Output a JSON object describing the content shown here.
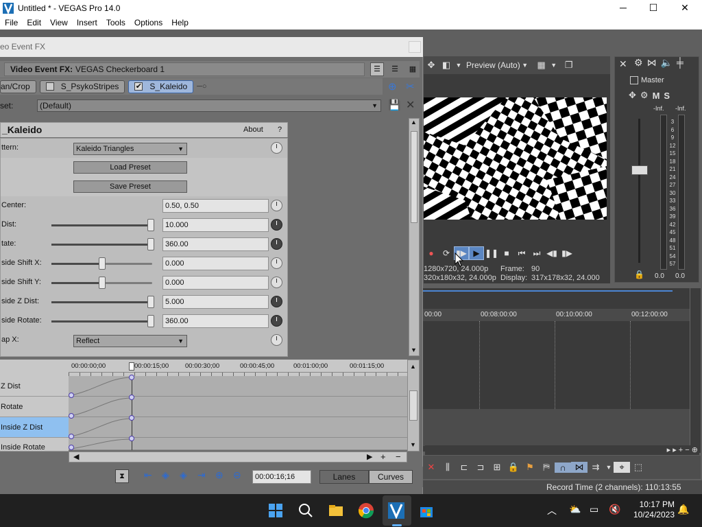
{
  "window": {
    "title": "Untitled * - VEGAS Pro 14.0",
    "controls": {
      "minimize": "─",
      "maximize": "☐",
      "close": "✕"
    }
  },
  "menu": [
    "File",
    "Edit",
    "View",
    "Insert",
    "Tools",
    "Options",
    "Help"
  ],
  "fx_window": {
    "title": "eo Event FX",
    "header_label": "Video Event FX:",
    "header_value": "VEGAS Checkerboard 1",
    "chain": [
      "an/Crop",
      "S_PsykoStripes",
      "S_Kaleido"
    ],
    "preset_label": "set:",
    "preset_value": "(Default)",
    "plugin_name": "_Kaleido",
    "about": "About",
    "help": "?",
    "params": [
      {
        "label": "ttern:",
        "type": "dropdown",
        "value": "Kaleido Triangles"
      },
      {
        "label": "",
        "type": "button",
        "value": "Load Preset"
      },
      {
        "label": "",
        "type": "button",
        "value": "Save Preset"
      },
      {
        "label": "  Center:",
        "type": "text",
        "value": "0.50, 0.50"
      },
      {
        "label": "Dist:",
        "type": "slider",
        "value": "10.000",
        "level": 1.0
      },
      {
        "label": "tate:",
        "type": "slider",
        "value": "360.00",
        "level": 1.0
      },
      {
        "label": "side Shift X:",
        "type": "slider",
        "value": "0.000",
        "level": 0.5
      },
      {
        "label": "side Shift Y:",
        "type": "slider",
        "value": "0.000",
        "level": 0.5
      },
      {
        "label": "side Z Dist:",
        "type": "slider",
        "value": "5.000",
        "level": 1.0
      },
      {
        "label": "side Rotate:",
        "type": "slider",
        "value": "360.00",
        "level": 1.0
      },
      {
        "label": "ap X:",
        "type": "dropdown",
        "value": "Reflect"
      }
    ],
    "kf_ruler": [
      "00:00:00;00",
      "00:00:15;00",
      "00:00:30;00",
      "00:00:45;00",
      "00:01:00;00",
      "00:01:15;00"
    ],
    "kf_tracks": [
      "Z Dist",
      "Rotate",
      "Inside Z Dist",
      "Inside Rotate"
    ],
    "time": "00:00:16;16",
    "lanes": "Lanes",
    "curves": "Curves"
  },
  "preview": {
    "mode": "Preview (Auto)",
    "info": {
      "project": "1280x720, 24.000p",
      "frame_label": "Frame:",
      "frame": "90",
      "preview_res": "320x180x32, 24.000p",
      "display_label": "Display:",
      "display": "317x178x32, 24.000"
    }
  },
  "master": {
    "label": "Master",
    "m": "M",
    "s": "S",
    "peak_left": "-Inf.",
    "peak_right": "-Inf.",
    "scale": [
      "3",
      "6",
      "9",
      "12",
      "15",
      "18",
      "21",
      "24",
      "27",
      "30",
      "33",
      "36",
      "39",
      "42",
      "45",
      "48",
      "51",
      "54",
      "57"
    ],
    "level_left": "0.0",
    "level_right": "0.0"
  },
  "timeline": {
    "marks": [
      "00:00",
      "00:08:00:00",
      "00:10:00:00",
      "00:12:00:00"
    ]
  },
  "status": {
    "record_time": "Record Time (2 channels): 110:13:55"
  },
  "taskbar": {
    "time": "10:17 PM",
    "date": "10/24/2023"
  },
  "colors": {
    "accent": "#3b66a8",
    "selected_track": "#8fc0f0",
    "keyframe": "#4b3ba8"
  }
}
